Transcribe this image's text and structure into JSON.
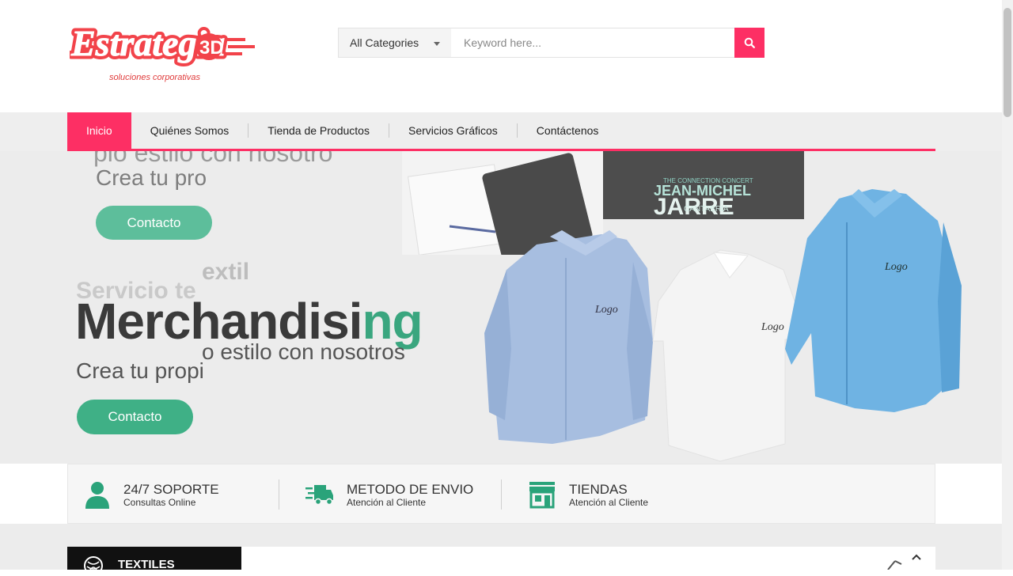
{
  "header": {
    "logo_text": "Estrategia 3D",
    "logo_sub": "soluciones corporativas",
    "search": {
      "category": "All Categories",
      "placeholder": "Keyword here..."
    }
  },
  "nav": {
    "items": [
      "Inicio",
      "Quiénes Somos",
      "Tienda de Productos",
      "Servicios Gráficos",
      "Contáctenos"
    ],
    "active": "Inicio"
  },
  "banner": {
    "ghost_line": "pio estilo con nosotro",
    "ghost_crea": "Crea tu pro",
    "ghost_button": "Contacto",
    "sub_left": "Servicio te",
    "sub_right": "extil",
    "merch_dark": "Merc",
    "merch_mid": "handisi",
    "merch_green": "ng",
    "tagline": "o estilo con nosotros",
    "crea": "Crea tu propi",
    "cta": "Contacto",
    "poster_line1": "THE CONNECTION CONCERT",
    "poster_line2": "JEAN-MICHEL",
    "poster_line3": "JARRE",
    "poster_line4": "CANTABRIA",
    "shirt_logo": "Logo"
  },
  "features": [
    {
      "title": "24/7 SOPORTE",
      "subtitle": "Consultas Online",
      "icon": "support-agent-icon"
    },
    {
      "title": "METODO DE ENVIO",
      "subtitle": "Atención al Cliente",
      "icon": "delivery-truck-icon"
    },
    {
      "title": "TIENDAS",
      "subtitle": "Atención al Cliente",
      "icon": "store-icon"
    }
  ],
  "section": {
    "title": "TEXTILES"
  },
  "colors": {
    "accent": "#fd2f64",
    "green": "#3aa67f",
    "icon_green": "#2aa37a",
    "logo_red": "#f2434a"
  }
}
